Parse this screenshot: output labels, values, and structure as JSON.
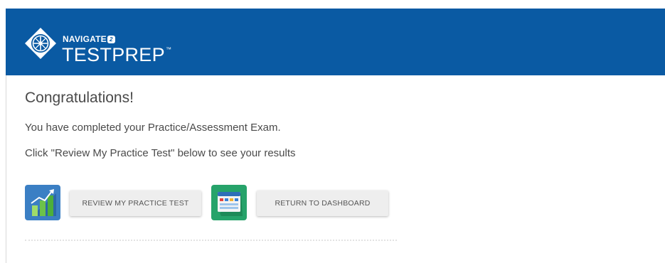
{
  "header": {
    "brand_top": "NAVIGATE",
    "brand_badge": "2",
    "brand_main": "TESTPREP",
    "brand_tm": "™",
    "background": "#0a5aa3"
  },
  "main": {
    "title": "Congratulations!",
    "message": "You have completed your Practice/Assessment Exam.",
    "instruction": "Click \"Review My Practice Test\" below to see your results"
  },
  "actions": {
    "review": {
      "label": "REVIEW MY PRACTICE TEST",
      "icon": "bar-chart-icon",
      "tile_color": "#3b7fc4"
    },
    "dashboard": {
      "label": "RETURN TO DASHBOARD",
      "icon": "dashboard-icon",
      "tile_color": "#26a36a"
    }
  }
}
